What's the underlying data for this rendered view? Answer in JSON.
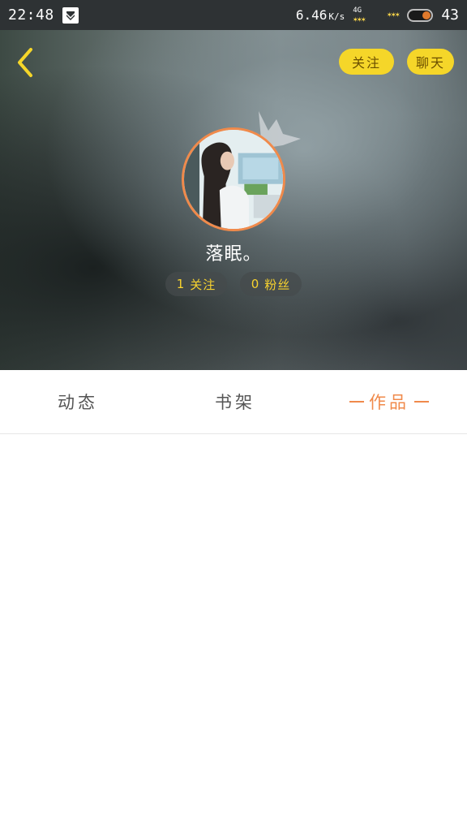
{
  "status_bar": {
    "time": "22:48",
    "net_speed": "6.46",
    "net_unit": "K/s",
    "network_type": "4G",
    "battery_level": "43"
  },
  "header": {
    "back_icon": "chevron-left-icon",
    "follow_label": "关注",
    "chat_label": "聊天",
    "accent_color": "#f5d629"
  },
  "profile": {
    "username": "落眠。",
    "following_count": "1",
    "following_label": "关注",
    "fans_count": "0",
    "fans_label": "粉丝",
    "avatar_border_color": "#f08a4b"
  },
  "tabs": [
    {
      "label": "动态",
      "active": false
    },
    {
      "label": "书架",
      "active": false
    },
    {
      "label": "作品",
      "active": true
    }
  ],
  "active_tab_color": "#f08a4b"
}
